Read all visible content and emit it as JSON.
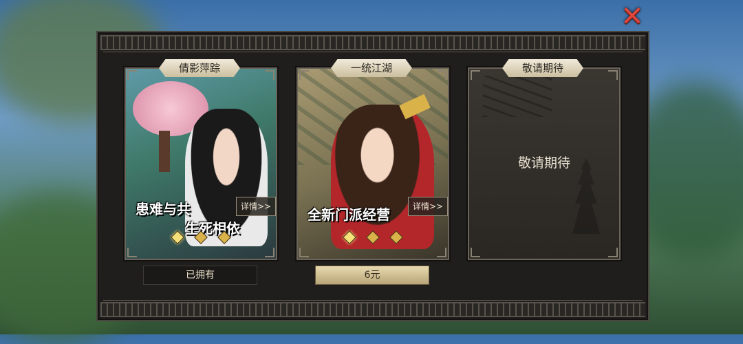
{
  "dialog": {
    "close_icon": "close-x-icon"
  },
  "cards": [
    {
      "title": "倩影萍踪",
      "slogan_line1": "患难与共",
      "slogan_line2": "生死相依",
      "detail_label": "详情>>",
      "status_label": "已拥有",
      "page_count": 3,
      "active_page": 1
    },
    {
      "title": "一统江湖",
      "slogan_line1": "全新门派经营",
      "detail_label": "详情>>",
      "status_label": "6元",
      "page_count": 3,
      "active_page": 1
    },
    {
      "title": "敬请期待",
      "center_text": "敬请期待"
    }
  ],
  "colors": {
    "accent_gold": "#d9b24a",
    "close_red": "#e0463a",
    "panel_dark": "#1f1e1c"
  }
}
